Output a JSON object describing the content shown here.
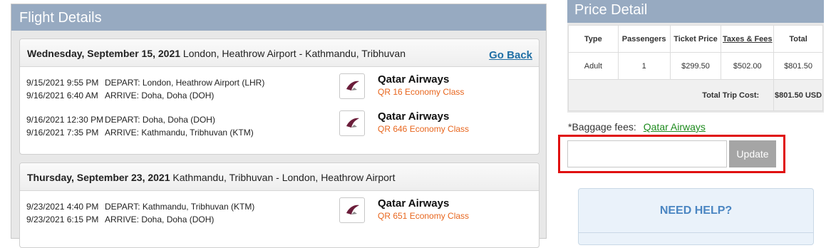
{
  "flight_details": {
    "title": "Flight Details",
    "go_back_label": "Go Back",
    "legs": [
      {
        "date": "Wednesday, September 15, 2021",
        "route": " London, Heathrow Airport - Kathmandu, Tribhuvan",
        "segments": [
          {
            "depart_time": "9/15/2021 9:55 PM",
            "depart_text": "DEPART: London, Heathrow Airport (LHR)",
            "arrive_time": "9/16/2021 6:40 AM",
            "arrive_text": "ARRIVE: Doha, Doha (DOH)",
            "airline": "Qatar Airways",
            "flight_class": "QR 16 Economy Class"
          },
          {
            "depart_time": "9/16/2021 12:30 PM",
            "depart_text": "DEPART: Doha, Doha (DOH)",
            "arrive_time": "9/16/2021 7:35 PM",
            "arrive_text": "ARRIVE: Kathmandu, Tribhuvan (KTM)",
            "airline": "Qatar Airways",
            "flight_class": "QR 646 Economy Class"
          }
        ]
      },
      {
        "date": "Thursday, September 23, 2021",
        "route": " Kathmandu, Tribhuvan - London, Heathrow Airport",
        "segments": [
          {
            "depart_time": "9/23/2021 4:40 PM",
            "depart_text": "DEPART: Kathmandu, Tribhuvan (KTM)",
            "arrive_time": "9/23/2021 6:15 PM",
            "arrive_text": "ARRIVE: Doha, Doha (DOH)",
            "airline": "Qatar Airways",
            "flight_class": "QR 651 Economy Class"
          }
        ]
      }
    ]
  },
  "price_detail": {
    "title": "Price Detail",
    "headers": [
      "Type",
      "Passengers",
      "Ticket Price",
      "Taxes & Fees",
      "Total"
    ],
    "rows": [
      {
        "type": "Adult",
        "passengers": "1",
        "ticket_price": "$299.50",
        "taxes_fees": "$502.00",
        "total": "$801.50"
      }
    ],
    "total_label": "Total Trip Cost:",
    "total_value": "$801.50 USD"
  },
  "baggage": {
    "label": "*Baggage fees:",
    "link": "Qatar Airways"
  },
  "promo": {
    "input_value": "",
    "button_label": "Update"
  },
  "help": {
    "title": "NEED HELP?"
  },
  "colors": {
    "header_bg": "#97aac1",
    "accent_orange": "#e8661e",
    "link_blue": "#1f6fa5",
    "green": "#1e8b1e",
    "highlight_red": "#e01010"
  }
}
